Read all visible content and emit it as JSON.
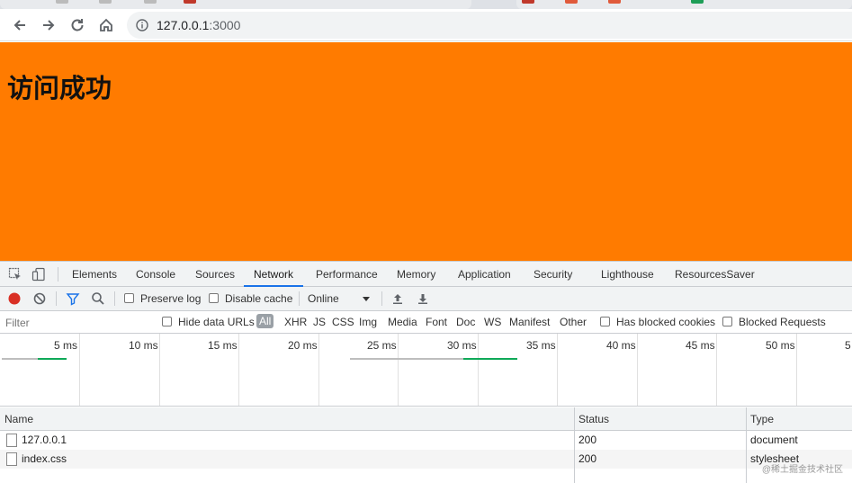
{
  "browser": {
    "url_host": "127.0.0.1",
    "url_port": ":3000"
  },
  "page": {
    "heading": "访问成功",
    "background_color": "#ff7b00"
  },
  "devtools": {
    "tabs": [
      "Elements",
      "Console",
      "Sources",
      "Network",
      "Performance",
      "Memory",
      "Application",
      "Security",
      "Lighthouse",
      "ResourcesSaver"
    ],
    "active_tab": "Network",
    "toolbar": {
      "preserve_log": "Preserve log",
      "disable_cache": "Disable cache",
      "throttling": "Online"
    },
    "filter": {
      "placeholder": "Filter",
      "hide_data_urls": "Hide data URLs",
      "types": [
        "All",
        "XHR",
        "JS",
        "CSS",
        "Img",
        "Media",
        "Font",
        "Doc",
        "WS",
        "Manifest",
        "Other"
      ],
      "has_blocked_cookies": "Has blocked cookies",
      "blocked_requests": "Blocked Requests"
    },
    "timeline": {
      "labels": [
        "5 ms",
        "10 ms",
        "15 ms",
        "20 ms",
        "25 ms",
        "30 ms",
        "35 ms",
        "40 ms",
        "45 ms",
        "50 ms",
        "5"
      ]
    },
    "grid": {
      "columns": [
        "Name",
        "Status",
        "Type"
      ],
      "rows": [
        {
          "name": "127.0.0.1",
          "status": "200",
          "type": "document"
        },
        {
          "name": "index.css",
          "status": "200",
          "type": "stylesheet"
        }
      ]
    }
  },
  "watermark": "@稀土掘金技术社区"
}
